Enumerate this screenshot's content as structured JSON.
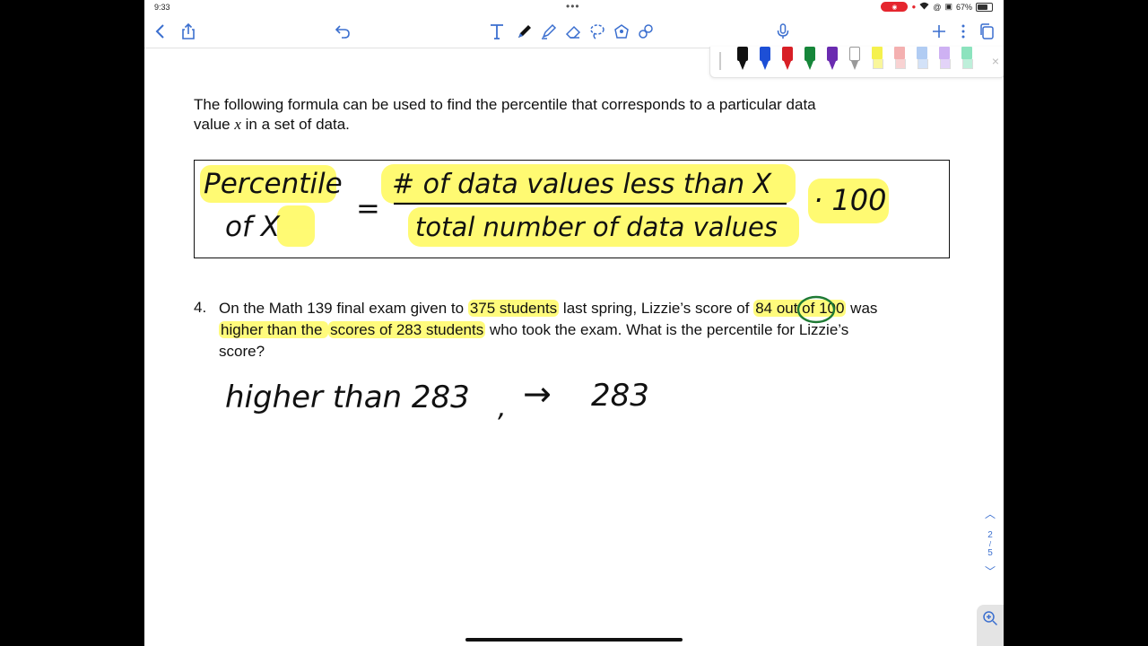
{
  "status": {
    "time": "9:33",
    "dots": "•••",
    "battery": "67%"
  },
  "toolbar": {
    "left_icons": [
      "chevron-left-icon",
      "share-icon",
      "undo-icon"
    ],
    "center_icons": [
      "text-tool-icon",
      "pen-tool-icon",
      "highlighter-tool-icon",
      "eraser-tool-icon",
      "lasso-tool-icon",
      "image-tool-icon",
      "shapes-tool-icon"
    ],
    "right_icons": [
      "microphone-icon",
      "plus-icon",
      "more-icon",
      "pages-icon"
    ],
    "accent": "#3b6fcf"
  },
  "palette": {
    "pens": [
      "#111111",
      "#1d4fd6",
      "#d81f26",
      "#16863a",
      "#6a2bb0"
    ],
    "highlighters": [
      "#f4ef3a",
      "#f3a7a7",
      "#a8c6f2",
      "#c9a8f2",
      "#7fe0b7"
    ],
    "close": "×"
  },
  "document": {
    "intro_line1": "The following formula can be used to find the percentile that corresponds to a particular data",
    "intro_line2_a": "value ",
    "intro_var": "x",
    "intro_line2_b": " in a set of data.",
    "formula": {
      "lhs_line1": "Percentile",
      "lhs_line2": "of  X",
      "equals": "=",
      "numerator": "# of data values less than X",
      "denominator": "total number of data values",
      "multiplier": "· 100"
    },
    "problem": {
      "number": "4.",
      "seg1": "On the Math 139 final exam given to ",
      "seg2": "375 students",
      "seg3": " last spring, Lizzie’s score of ",
      "seg4": "84 out of 100",
      "seg5": " was",
      "seg6": "higher than the ",
      "seg7": "scores of 283 students",
      "seg8": " who took the exam. What is the percentile for Lizzie’s",
      "seg9": "score?"
    },
    "handwriting": {
      "text1": "higher  than  283",
      "comma": ",",
      "arrow": "→",
      "text2": "283"
    }
  },
  "page_nav": {
    "current": "2",
    "separator": "/",
    "total": "5"
  },
  "colors": {
    "highlight": "#fff950",
    "ink": "#111111",
    "circle": "#1e7a34"
  }
}
